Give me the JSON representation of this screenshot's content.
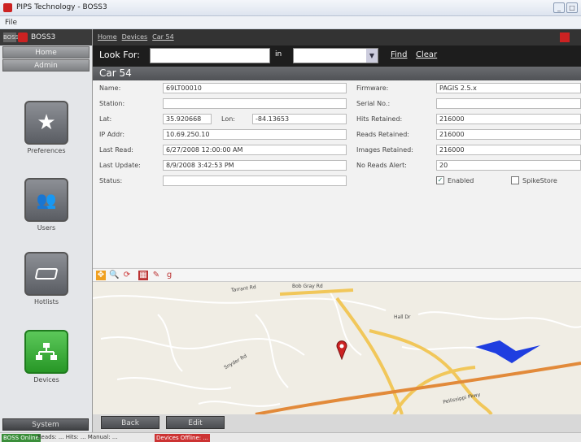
{
  "window": {
    "title": "PIPS Technology - BOSS3",
    "menu_file": "File"
  },
  "sidebar": {
    "version": "BOSS",
    "app_name": "BOSS3",
    "home": "Home",
    "admin": "Admin",
    "tiles": [
      {
        "label": "Preferences",
        "icon": "star-icon"
      },
      {
        "label": "Users",
        "icon": "users-icon"
      },
      {
        "label": "Hotlists",
        "icon": "hotlist-icon"
      },
      {
        "label": "Devices",
        "icon": "network-icon"
      }
    ],
    "system": "System"
  },
  "breadcrumb": [
    "Home",
    "Devices",
    "Car 54"
  ],
  "lookfor": {
    "label": "Look For:",
    "in": "in",
    "find": "Find",
    "clear": "Clear"
  },
  "section_title": "Car 54",
  "fields": {
    "name": {
      "label": "Name:",
      "value": "69LT00010"
    },
    "station": {
      "label": "Station:",
      "value": ""
    },
    "lat": {
      "label": "Lat:",
      "value": "35.920668"
    },
    "lon": {
      "label": "Lon:",
      "value": "-84.13653"
    },
    "ip": {
      "label": "IP Addr:",
      "value": "10.69.250.10"
    },
    "last_read": {
      "label": "Last Read:",
      "value": "6/27/2008 12:00:00 AM"
    },
    "last_update": {
      "label": "Last Update:",
      "value": "8/9/2008 3:42:53 PM"
    },
    "status": {
      "label": "Status:",
      "value": ""
    },
    "firmware": {
      "label": "Firmware:",
      "value": "PAGIS 2.5.x"
    },
    "serial": {
      "label": "Serial No.:",
      "value": ""
    },
    "hits": {
      "label": "Hits Retained:",
      "value": "216000"
    },
    "reads": {
      "label": "Reads Retained:",
      "value": "216000"
    },
    "images": {
      "label": "Images Retained:",
      "value": "216000"
    },
    "noreads": {
      "label": "No Reads Alert:",
      "value": "20"
    },
    "enabled": {
      "label": "Enabled",
      "checked": true
    },
    "spikestore": {
      "label": "SpikeStore",
      "checked": false
    }
  },
  "map_labels": {
    "road1": "Tarrant Rd",
    "road2": "Bob Gray Rd",
    "road3": "Hall Dr",
    "road4": "Snyder Rd",
    "road5": "Pellissippi Pkwy"
  },
  "buttons": {
    "back": "Back",
    "edit": "Edit"
  },
  "status": {
    "online": "BOSS Online",
    "reads": "Reads: ... Hits: ... Manual: ...",
    "offline": "Devices Offline: ..."
  }
}
